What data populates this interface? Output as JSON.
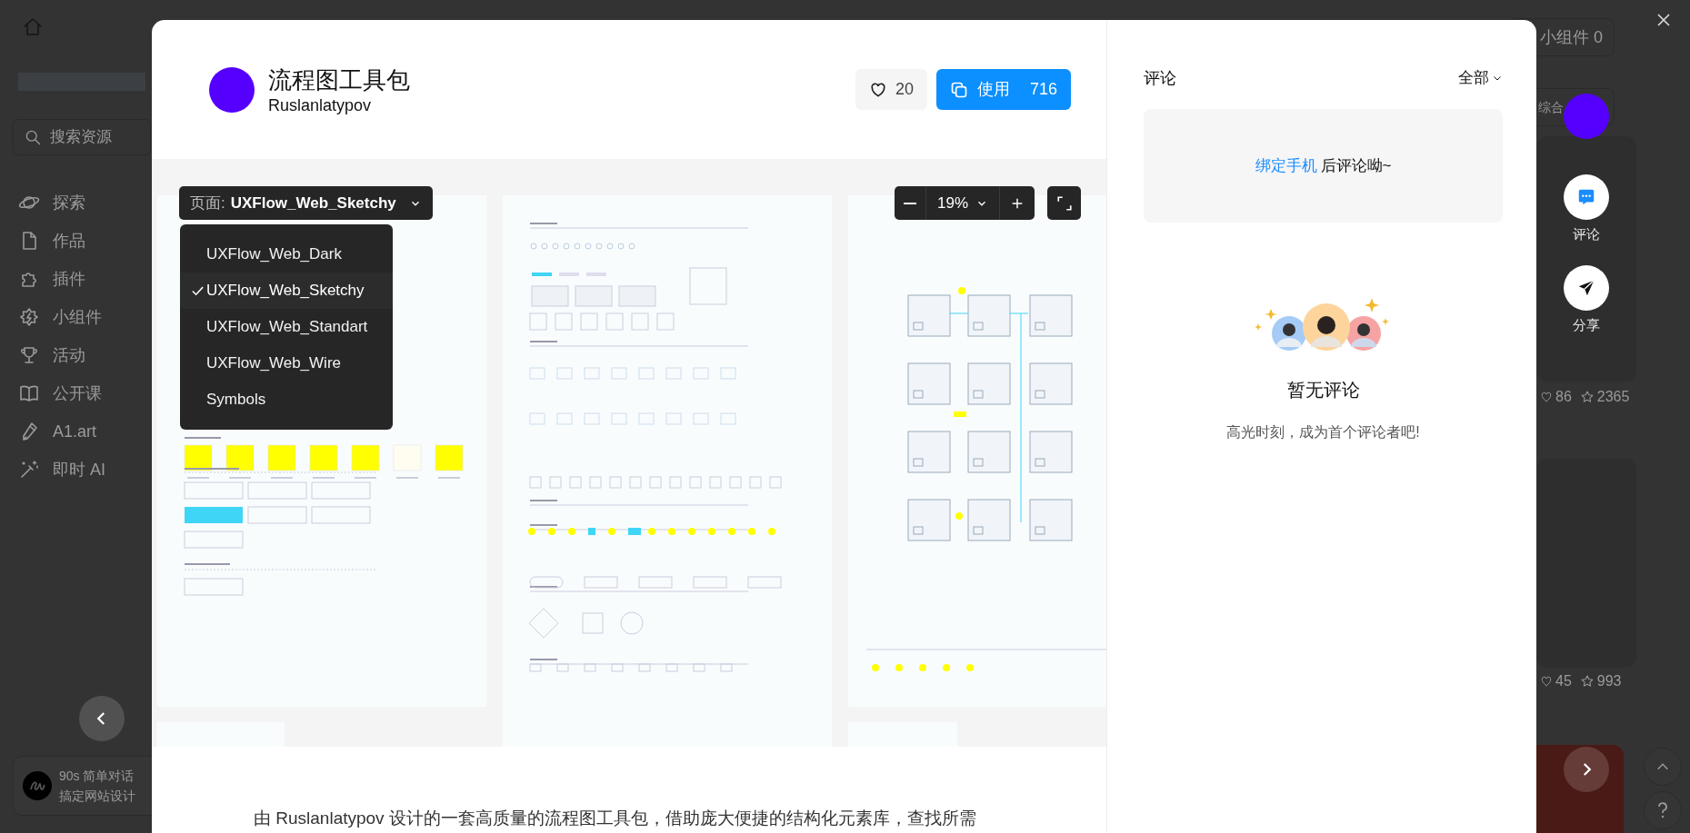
{
  "background": {
    "sidebar": {
      "search_placeholder": "搜索资源",
      "items": [
        {
          "kind": "planet",
          "label": "探索"
        },
        {
          "kind": "file",
          "label": "作品"
        },
        {
          "kind": "puzzle",
          "label": "插件"
        },
        {
          "kind": "badge",
          "label": "小组件"
        },
        {
          "kind": "trophy",
          "label": "活动"
        },
        {
          "kind": "book",
          "label": "公开课"
        },
        {
          "kind": "pen",
          "label": "A1.art"
        },
        {
          "kind": "wand",
          "label": "即时 AI"
        }
      ]
    },
    "promo": {
      "title": "90s 简单对话",
      "subtitle": "搞定网站设计"
    },
    "widget_button": "小组件 0",
    "sort_button": "综合",
    "card_stats": [
      {
        "likes": "86",
        "stars": "2365"
      },
      {
        "likes": "45",
        "stars": "993"
      }
    ]
  },
  "modal": {
    "title": "流程图工具包",
    "author": "Ruslanlatypov",
    "like_count": "20",
    "use_button": {
      "label": "使用",
      "count": "716"
    },
    "preview": {
      "page_selector": {
        "prefix": "页面:",
        "value": "UXFlow_Web_Sketchy"
      },
      "pages": [
        {
          "label": "UXFlow_Web_Dark",
          "selected": false
        },
        {
          "label": "UXFlow_Web_Sketchy",
          "selected": true
        },
        {
          "label": "UXFlow_Web_Standart",
          "selected": false
        },
        {
          "label": "UXFlow_Web_Wire",
          "selected": false
        },
        {
          "label": "Symbols",
          "selected": false
        }
      ],
      "zoom": "19%"
    },
    "description": "由 Ruslanlatypov 设计的一套高质量的流程图工具包，借助庞大便捷的结构化元素库，查找所需"
  },
  "comments": {
    "title": "评论",
    "filter": "全部",
    "prompt": {
      "link": "绑定手机",
      "text": "后评论呦~"
    },
    "empty_title": "暂无评论",
    "empty_text": "高光时刻，成为首个评论者吧!"
  },
  "side_actions": [
    {
      "kind": "comment",
      "label": "评论"
    },
    {
      "kind": "share",
      "label": "分享"
    }
  ]
}
